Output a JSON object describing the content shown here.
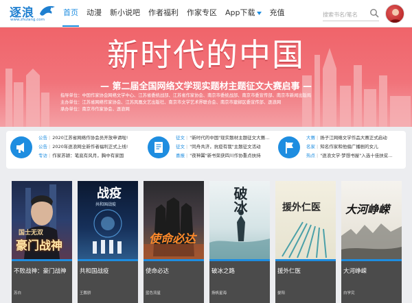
{
  "header": {
    "logo_text": "逐浪",
    "logo_url": "www.zhulang.com",
    "nav": [
      "首页",
      "动漫",
      "新小说吧",
      "作者福利",
      "作家专区",
      "App下载",
      "充值"
    ],
    "search_placeholder": "搜索书名/笔名"
  },
  "banner": {
    "title": "新时代的中国",
    "subtitle": "— 第二届全国网络文学现实题材主题征文大赛启事 —",
    "orgs": [
      "指导单位：中国作家协会网络文学中心、江苏省委统战部、江苏省作家协会、南京市委统战部、南京市委宣传部、南京市新闻出版局",
      "主办单位：江苏省网络作家协会、江苏凤凰文艺出版社、南京市文学艺术界联合会、南京市建邺区委宣传部、逐浪网",
      "承办单位：南京市作家协会、逐浪网"
    ]
  },
  "info": {
    "columns": [
      {
        "icon": "megaphone-icon",
        "lines": [
          {
            "tag": "公告",
            "text": "2020江苏省网络作协会员开放申请啦!"
          },
          {
            "tag": "公告",
            "text": "2020年逐浪网全新作者福利正式上线!"
          },
          {
            "tag": "专访",
            "text": "作家苏颖：笔底有风月，胸中有家国"
          }
        ]
      },
      {
        "icon": "document-edit-icon",
        "lines": [
          {
            "tag": "征文",
            "text": "\"新时代的中国\"现实题材主题征文大赛..."
          },
          {
            "tag": "征文",
            "text": "\"同舟共济，抗疫有我\"主题征文活动"
          },
          {
            "tag": "喜报",
            "text": "\"夜神翼\"新书荣获四川作协重点扶持"
          }
        ]
      },
      {
        "icon": "flag-icon",
        "lines": [
          {
            "tag": "大赛",
            "text": "扬子江网络文学作品大赛正式启动"
          },
          {
            "tag": "名家",
            "text": "知名作家和他偏广播剧的女儿"
          },
          {
            "tag": "热点",
            "text": "\"逐浪文学·梦想书屋\"入选十佳扶贫..."
          }
        ]
      }
    ]
  },
  "books": [
    {
      "title": "不败战神：豪门战神",
      "author": "苏白",
      "cover_text": "豪门战神",
      "cover_sub": "国士无双"
    },
    {
      "title": "共和国战疫",
      "author": "王鹏骄",
      "cover_text": "战疫",
      "cover_sub": "共和国战疫"
    },
    {
      "title": "使命必达",
      "author": "蓝色流星",
      "cover_text": "使命必达",
      "cover_sub": ""
    },
    {
      "title": "破冰之路",
      "author": "扬帆星海",
      "cover_text": "破冰",
      "cover_sub": ""
    },
    {
      "title": "援外仁医",
      "author": "晏阳",
      "cover_text": "援外仁医",
      "cover_sub": ""
    },
    {
      "title": "大河峥嵘",
      "author": "白学究",
      "cover_text": "大河峥嵘",
      "cover_sub": ""
    }
  ]
}
